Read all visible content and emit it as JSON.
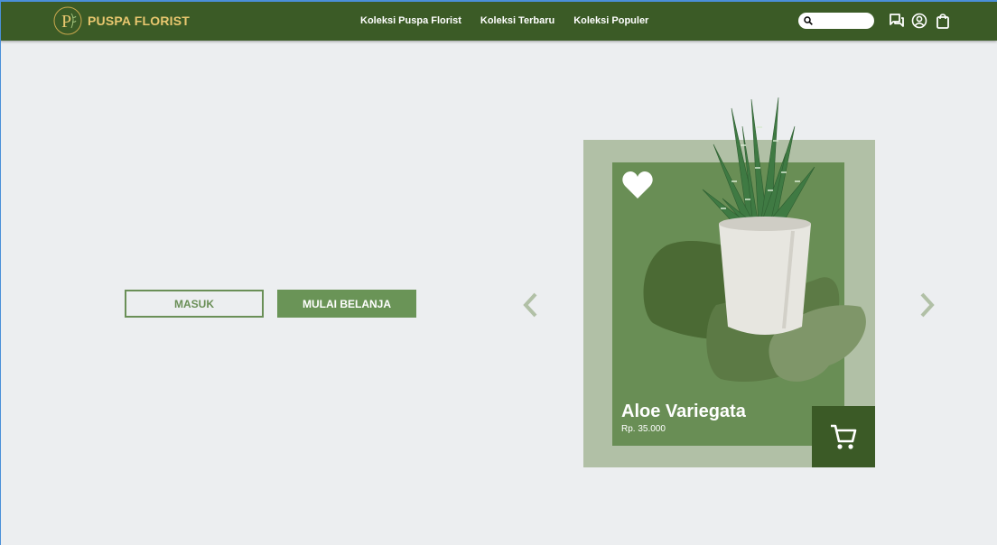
{
  "brand": {
    "name": "PUSPA FLORIST",
    "logo_letter": "P",
    "logo_icon": "floral-p-monogram",
    "colors": {
      "header": "#3b5b26",
      "gold": "#e8c76f",
      "accent": "#6a9457"
    }
  },
  "nav": {
    "items": [
      {
        "label": "Koleksi Puspa Florist"
      },
      {
        "label": "Koleksi Terbaru"
      },
      {
        "label": "Koleksi Populer"
      }
    ]
  },
  "search": {
    "placeholder": "",
    "icon": "search-icon"
  },
  "header_icons": [
    "chat-icon",
    "user-icon",
    "shopping-bag-icon"
  ],
  "hero": {
    "login_label": "MASUK",
    "shop_label": "MULAI BELANJA"
  },
  "carousel": {
    "prev_icon": "chevron-left-icon",
    "next_icon": "chevron-right-icon",
    "product": {
      "name": "Aloe Variegata",
      "price": "Rp. 35.000",
      "favorite_icon": "heart-icon",
      "cart_icon": "cart-icon"
    }
  }
}
